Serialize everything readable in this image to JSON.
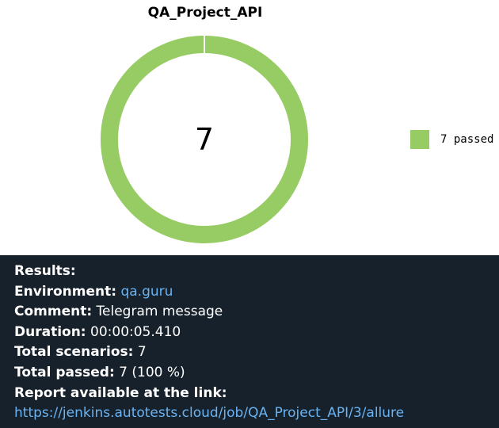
{
  "chart_data": {
    "type": "pie",
    "style": "donut",
    "title": "QA_Project_API",
    "center_label": "7",
    "categories": [
      "passed"
    ],
    "values": [
      7
    ],
    "legend": [
      "7 passed"
    ],
    "legend_position": "right",
    "colors": [
      "#97cc64"
    ]
  },
  "results": {
    "heading": "Results:",
    "environment_key": "Environment:",
    "environment_value": "qa.guru",
    "comment_key": "Comment:",
    "comment_value": "Telegram message",
    "duration_key": "Duration:",
    "duration_value": "00:00:05.410",
    "total_scenarios_key": "Total scenarios:",
    "total_scenarios_value": "7",
    "total_passed_key": "Total passed:",
    "total_passed_value": "7 (100 %)",
    "report_key": "Report available at the link:",
    "report_link": "https://jenkins.autotests.cloud/job/QA_Project_API/3/allure"
  },
  "colors": {
    "panel_bg": "#17212b",
    "text": "#ffffff",
    "link": "#6ab3f3",
    "passed": "#97cc64"
  }
}
